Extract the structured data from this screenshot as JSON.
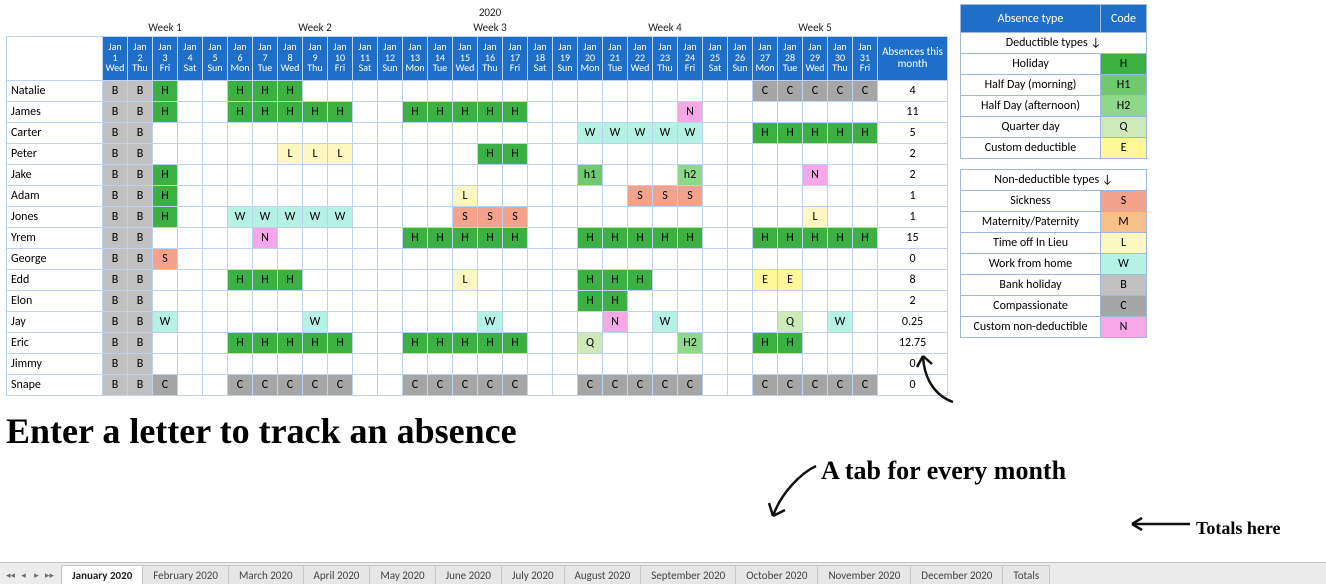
{
  "year": "2020",
  "weeks": [
    "Week 1",
    "Week 2",
    "Week 3",
    "Week 4",
    "Week 5"
  ],
  "week_span": [
    5,
    7,
    7,
    7,
    5
  ],
  "days": [
    {
      "m": "Jan",
      "d": "1",
      "w": "Wed"
    },
    {
      "m": "Jan",
      "d": "2",
      "w": "Thu"
    },
    {
      "m": "Jan",
      "d": "3",
      "w": "Fri"
    },
    {
      "m": "Jan",
      "d": "4",
      "w": "Sat"
    },
    {
      "m": "Jan",
      "d": "5",
      "w": "Sun"
    },
    {
      "m": "Jan",
      "d": "6",
      "w": "Mon"
    },
    {
      "m": "Jan",
      "d": "7",
      "w": "Tue"
    },
    {
      "m": "Jan",
      "d": "8",
      "w": "Wed"
    },
    {
      "m": "Jan",
      "d": "9",
      "w": "Thu"
    },
    {
      "m": "Jan",
      "d": "10",
      "w": "Fri"
    },
    {
      "m": "Jan",
      "d": "11",
      "w": "Sat"
    },
    {
      "m": "Jan",
      "d": "12",
      "w": "Sun"
    },
    {
      "m": "Jan",
      "d": "13",
      "w": "Mon"
    },
    {
      "m": "Jan",
      "d": "14",
      "w": "Tue"
    },
    {
      "m": "Jan",
      "d": "15",
      "w": "Wed"
    },
    {
      "m": "Jan",
      "d": "16",
      "w": "Thu"
    },
    {
      "m": "Jan",
      "d": "17",
      "w": "Fri"
    },
    {
      "m": "Jan",
      "d": "18",
      "w": "Sat"
    },
    {
      "m": "Jan",
      "d": "19",
      "w": "Sun"
    },
    {
      "m": "Jan",
      "d": "20",
      "w": "Mon"
    },
    {
      "m": "Jan",
      "d": "21",
      "w": "Tue"
    },
    {
      "m": "Jan",
      "d": "22",
      "w": "Wed"
    },
    {
      "m": "Jan",
      "d": "23",
      "w": "Thu"
    },
    {
      "m": "Jan",
      "d": "24",
      "w": "Fri"
    },
    {
      "m": "Jan",
      "d": "25",
      "w": "Sat"
    },
    {
      "m": "Jan",
      "d": "26",
      "w": "Sun"
    },
    {
      "m": "Jan",
      "d": "27",
      "w": "Mon"
    },
    {
      "m": "Jan",
      "d": "28",
      "w": "Tue"
    },
    {
      "m": "Jan",
      "d": "29",
      "w": "Wed"
    },
    {
      "m": "Jan",
      "d": "30",
      "w": "Thu"
    },
    {
      "m": "Jan",
      "d": "31",
      "w": "Fri"
    }
  ],
  "abs_header": "Absences this month",
  "rows": [
    {
      "name": "Natalie",
      "cells": [
        "B",
        "B",
        "H",
        "",
        "",
        "H",
        "H",
        "H",
        "",
        "",
        "",
        "",
        "",
        "",
        "",
        "",
        "",
        "",
        "",
        "",
        "",
        "",
        "",
        "",
        "",
        "",
        "C",
        "C",
        "C",
        "C",
        "C"
      ],
      "abs": "4"
    },
    {
      "name": "James",
      "cells": [
        "B",
        "B",
        "H",
        "",
        "",
        "H",
        "H",
        "H",
        "H",
        "H",
        "",
        "",
        "H",
        "H",
        "H",
        "H",
        "H",
        "",
        "",
        "",
        "",
        "",
        "",
        "N",
        "",
        "",
        "",
        "",
        "",
        "",
        ""
      ],
      "abs": "11"
    },
    {
      "name": "Carter",
      "cells": [
        "B",
        "B",
        "",
        "",
        "",
        "",
        "",
        "",
        "",
        "",
        "",
        "",
        "",
        "",
        "",
        "",
        "",
        "",
        "",
        "W",
        "W",
        "W",
        "W",
        "W",
        "",
        "",
        "H",
        "H",
        "H",
        "H",
        "H"
      ],
      "abs": "5"
    },
    {
      "name": "Peter",
      "cells": [
        "B",
        "B",
        "",
        "",
        "",
        "",
        "",
        "L",
        "L",
        "L",
        "",
        "",
        "",
        "",
        "",
        "H",
        "H",
        "",
        "",
        "",
        "",
        "",
        "",
        "",
        "",
        "",
        "",
        "",
        "",
        "",
        ""
      ],
      "abs": "2"
    },
    {
      "name": "Jake",
      "cells": [
        "B",
        "B",
        "H",
        "",
        "",
        "",
        "",
        "",
        "",
        "",
        "",
        "",
        "",
        "",
        "",
        "",
        "",
        "",
        "",
        "h1",
        "",
        "",
        "",
        "h2",
        "",
        "",
        "",
        "",
        "N",
        "",
        ""
      ],
      "abs": "2"
    },
    {
      "name": "Adam",
      "cells": [
        "B",
        "B",
        "H",
        "",
        "",
        "",
        "",
        "",
        "",
        "",
        "",
        "",
        "",
        "",
        "L",
        "",
        "",
        "",
        "",
        "",
        "",
        "S",
        "S",
        "S",
        "",
        "",
        "",
        "",
        "",
        "",
        ""
      ],
      "abs": "1"
    },
    {
      "name": "Jones",
      "cells": [
        "B",
        "B",
        "H",
        "",
        "",
        "W",
        "W",
        "W",
        "W",
        "W",
        "",
        "",
        "",
        "",
        "S",
        "S",
        "S",
        "",
        "",
        "",
        "",
        "",
        "",
        "",
        "",
        "",
        "",
        "",
        "L",
        "",
        ""
      ],
      "abs": "1"
    },
    {
      "name": "Yrem",
      "cells": [
        "B",
        "B",
        "",
        "",
        "",
        "",
        "N",
        "",
        "",
        "",
        "",
        "",
        "H",
        "H",
        "H",
        "H",
        "H",
        "",
        "",
        "H",
        "H",
        "H",
        "H",
        "H",
        "",
        "",
        "H",
        "H",
        "H",
        "H",
        "H"
      ],
      "abs": "15"
    },
    {
      "name": "George",
      "cells": [
        "B",
        "B",
        "S",
        "",
        "",
        "",
        "",
        "",
        "",
        "",
        "",
        "",
        "",
        "",
        "",
        "",
        "",
        "",
        "",
        "",
        "",
        "",
        "",
        "",
        "",
        "",
        "",
        "",
        "",
        "",
        ""
      ],
      "abs": "0"
    },
    {
      "name": "Edd",
      "cells": [
        "B",
        "B",
        "",
        "",
        "",
        "H",
        "H",
        "H",
        "",
        "",
        "",
        "",
        "",
        "",
        "L",
        "",
        "",
        "",
        "",
        "H",
        "H",
        "H",
        "",
        "",
        "",
        "",
        "E",
        "E",
        "",
        "",
        ""
      ],
      "abs": "8"
    },
    {
      "name": "Elon",
      "cells": [
        "B",
        "B",
        "",
        "",
        "",
        "",
        "",
        "",
        "",
        "",
        "",
        "",
        "",
        "",
        "",
        "",
        "",
        "",
        "",
        "H",
        "H",
        "",
        "",
        "",
        "",
        "",
        "",
        "",
        "",
        "",
        ""
      ],
      "abs": "2"
    },
    {
      "name": "Jay",
      "cells": [
        "B",
        "B",
        "W",
        "",
        "",
        "",
        "",
        "",
        "W",
        "",
        "",
        "",
        "",
        "",
        "",
        "W",
        "",
        "",
        "",
        "",
        "N",
        "",
        "W",
        "",
        "",
        "",
        "",
        "Q",
        "",
        "W",
        ""
      ],
      "abs": "0.25"
    },
    {
      "name": "Eric",
      "cells": [
        "B",
        "B",
        "",
        "",
        "",
        "H",
        "H",
        "H",
        "H",
        "H",
        "",
        "",
        "H",
        "H",
        "H",
        "H",
        "H",
        "",
        "",
        "Q",
        "",
        "",
        "",
        "H2",
        "",
        "",
        "H",
        "H",
        "",
        "",
        ""
      ],
      "abs": "12.75"
    },
    {
      "name": "Jimmy",
      "cells": [
        "B",
        "B",
        "",
        "",
        "",
        "",
        "",
        "",
        "",
        "",
        "",
        "",
        "",
        "",
        "",
        "",
        "",
        "",
        "",
        "",
        "",
        "",
        "",
        "",
        "",
        "",
        "",
        "",
        "",
        "",
        ""
      ],
      "abs": "0"
    },
    {
      "name": "Snape",
      "cells": [
        "B",
        "B",
        "C",
        "",
        "",
        "C",
        "C",
        "C",
        "C",
        "C",
        "",
        "",
        "C",
        "C",
        "C",
        "C",
        "C",
        "",
        "",
        "C",
        "C",
        "C",
        "C",
        "C",
        "",
        "",
        "C",
        "C",
        "C",
        "C",
        "C"
      ],
      "abs": "0"
    }
  ],
  "legend": {
    "head_type": "Absence type",
    "head_code": "Code",
    "sect1": "Deductible types ↓",
    "sect2": "Non-deductible types ↓",
    "d": [
      {
        "t": "Holiday",
        "c": "H",
        "cls": "c-H"
      },
      {
        "t": "Half Day (morning)",
        "c": "H1",
        "cls": "c-H1"
      },
      {
        "t": "Half Day (afternoon)",
        "c": "H2",
        "cls": "c-H2"
      },
      {
        "t": "Quarter day",
        "c": "Q",
        "cls": "c-Q"
      },
      {
        "t": "Custom deductible",
        "c": "E",
        "cls": "c-E"
      }
    ],
    "n": [
      {
        "t": "Sickness",
        "c": "S",
        "cls": "c-S"
      },
      {
        "t": "Maternity/Paternity",
        "c": "M",
        "cls": "c-M"
      },
      {
        "t": "Time off In Lieu",
        "c": "L",
        "cls": "c-L"
      },
      {
        "t": "Work from home",
        "c": "W",
        "cls": "c-W"
      },
      {
        "t": "Bank holiday",
        "c": "B",
        "cls": "c-B"
      },
      {
        "t": "Compassionate",
        "c": "C",
        "cls": "c-C"
      },
      {
        "t": "Custom non-deductible",
        "c": "N",
        "cls": "c-N"
      }
    ]
  },
  "annot": {
    "a": "Enter a letter to track an absence",
    "b": "A tab for every month",
    "c": "Totals here"
  },
  "tabs": [
    "January 2020",
    "February 2020",
    "March 2020",
    "April 2020",
    "May 2020",
    "June 2020",
    "July 2020",
    "August 2020",
    "September 2020",
    "October 2020",
    "November 2020",
    "December 2020",
    "Totals"
  ],
  "active_tab": 0,
  "code_class": {
    "B": "c-B",
    "C": "c-C",
    "H": "c-H",
    "H1": "c-H1",
    "h1": "c-H1",
    "H2": "c-H2",
    "h2": "c-H2",
    "Q": "c-Q",
    "E": "c-E",
    "L": "c-L",
    "S": "c-S",
    "M": "c-M",
    "W": "c-W",
    "N": "c-N"
  }
}
